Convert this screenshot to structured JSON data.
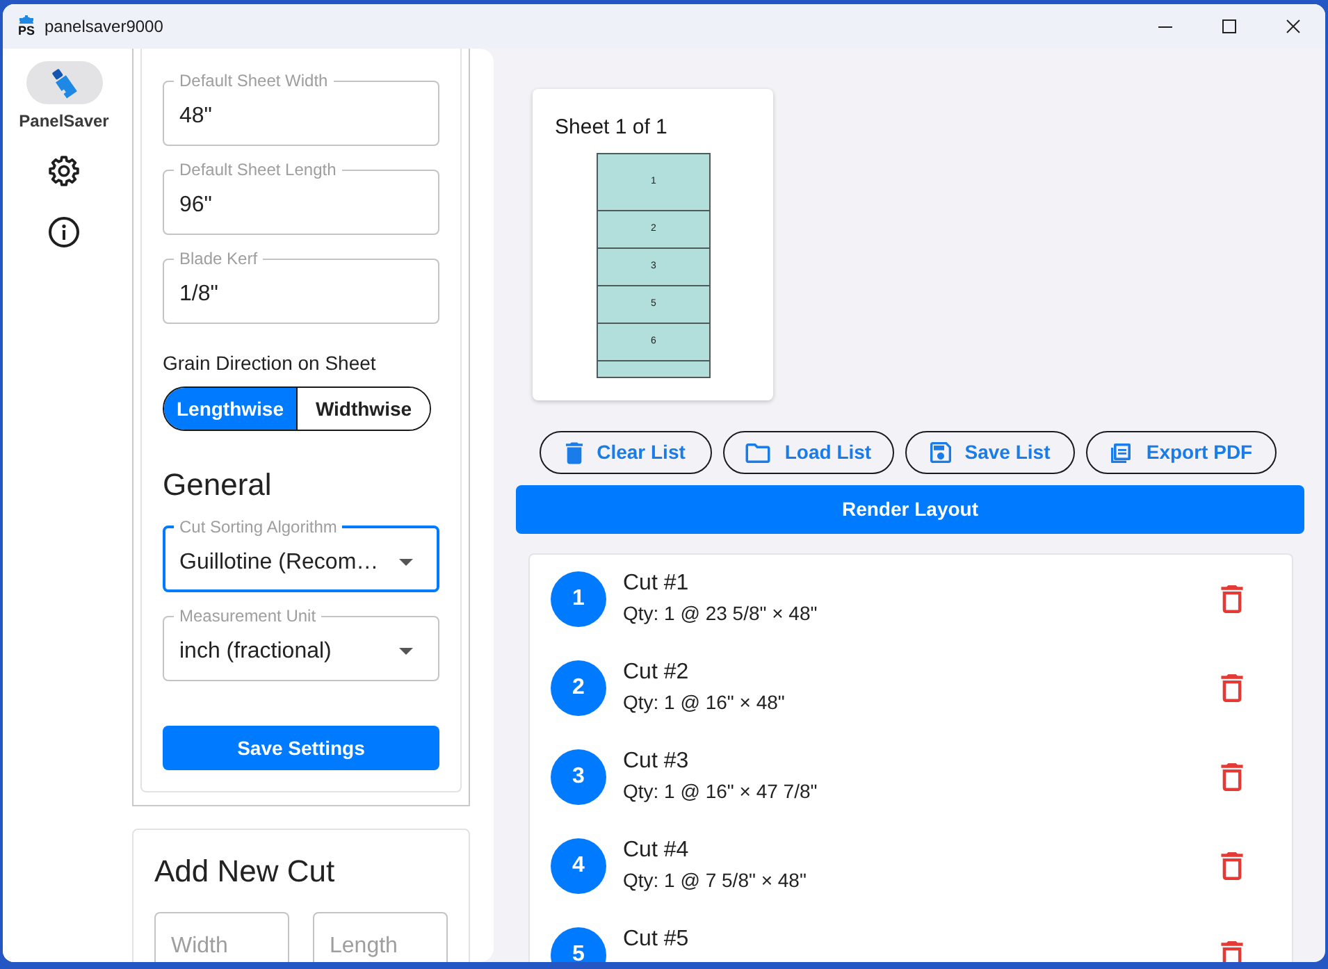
{
  "window": {
    "title": "panelsaver9000",
    "logo_text": "PS"
  },
  "nav": {
    "items": [
      {
        "label": "PanelSaver",
        "selected": true
      },
      {
        "selected": false
      },
      {
        "selected": false
      }
    ]
  },
  "sheet_settings": {
    "fields": [
      {
        "label": "Default Sheet Width",
        "value": "48\""
      },
      {
        "label": "Default Sheet Length",
        "value": "96\""
      },
      {
        "label": "Blade Kerf",
        "value": "1/8\""
      }
    ],
    "grain_direction": {
      "label": "Grain Direction on Sheet",
      "options": [
        {
          "label": "Lengthwise",
          "selected": true
        },
        {
          "label": "Widthwise",
          "selected": false
        }
      ]
    }
  },
  "general": {
    "heading": "General",
    "selects": [
      {
        "label": "Cut Sorting Algorithm",
        "value": "Guillotine (Recom…",
        "focused": true
      },
      {
        "label": "Measurement Unit",
        "value": "inch (fractional)",
        "focused": false
      }
    ],
    "save_button": "Save Settings"
  },
  "add_cut": {
    "heading": "Add New Cut",
    "fields": [
      {
        "placeholder": "Width"
      },
      {
        "placeholder": "Length"
      }
    ]
  },
  "sheet_preview": {
    "title": "Sheet 1 of 1",
    "pieces": [
      {
        "label": "1"
      },
      {
        "label": "2"
      },
      {
        "label": "3"
      },
      {
        "label": "5"
      },
      {
        "label": "6"
      }
    ]
  },
  "actions": [
    {
      "label": "Clear List"
    },
    {
      "label": "Load List"
    },
    {
      "label": "Save List"
    },
    {
      "label": "Export PDF"
    }
  ],
  "render_button": "Render Layout",
  "cuts": [
    {
      "number": "1",
      "title": "Cut #1",
      "detail": "Qty: 1 @ 23 5/8\" × 48\""
    },
    {
      "number": "2",
      "title": "Cut #2",
      "detail": "Qty: 1 @ 16\" × 48\""
    },
    {
      "number": "3",
      "title": "Cut #3",
      "detail": "Qty: 1 @ 16\" × 47 7/8\""
    },
    {
      "number": "4",
      "title": "Cut #4",
      "detail": "Qty: 1 @ 7 5/8\" × 48\""
    },
    {
      "number": "5",
      "title": "Cut #5"
    }
  ]
}
